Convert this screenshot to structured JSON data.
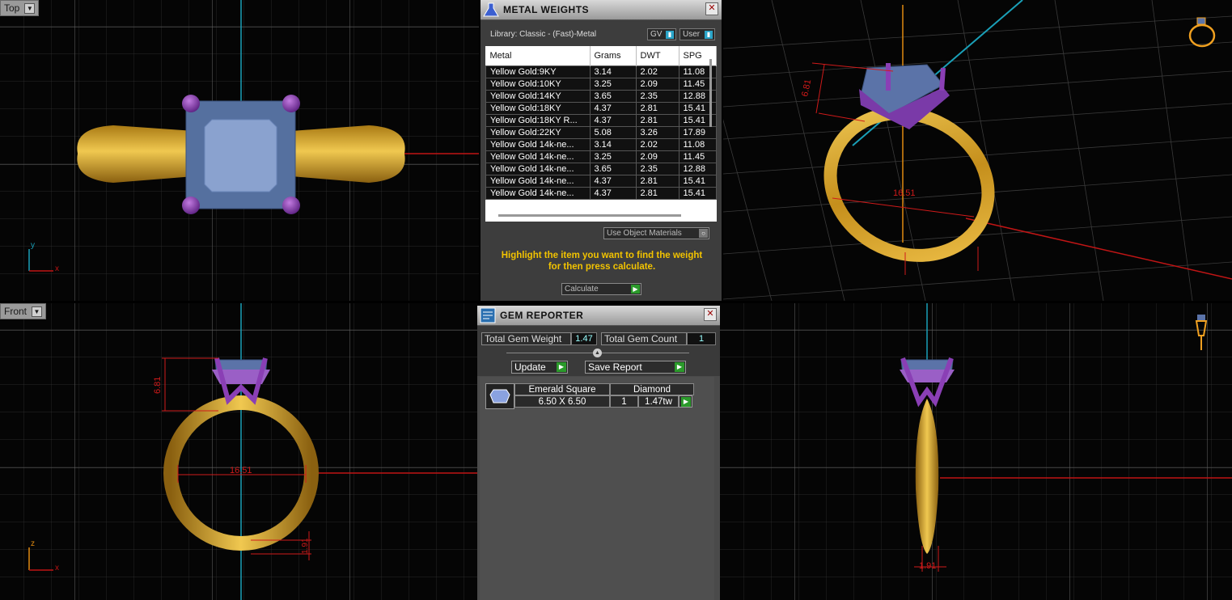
{
  "viewports": {
    "top": {
      "label": "Top"
    },
    "front": {
      "label": "Front"
    }
  },
  "metal_weights": {
    "title": "METAL WEIGHTS",
    "library_label": "Library: Classic - (Fast)-Metal",
    "toggle_gv": "GV",
    "toggle_user": "User",
    "columns": [
      "Metal",
      "Grams",
      "DWT",
      "SPG"
    ],
    "rows": [
      [
        "Yellow Gold:9KY",
        "3.14",
        "2.02",
        "11.08"
      ],
      [
        "Yellow Gold:10KY",
        "3.25",
        "2.09",
        "11.45"
      ],
      [
        "Yellow Gold:14KY",
        "3.65",
        "2.35",
        "12.88"
      ],
      [
        "Yellow Gold:18KY",
        "4.37",
        "2.81",
        "15.41"
      ],
      [
        "Yellow Gold:18KY R...",
        "4.37",
        "2.81",
        "15.41"
      ],
      [
        "Yellow Gold:22KY",
        "5.08",
        "3.26",
        "17.89"
      ],
      [
        "Yellow Gold 14k-ne...",
        "3.14",
        "2.02",
        "11.08"
      ],
      [
        "Yellow Gold 14k-ne...",
        "3.25",
        "2.09",
        "11.45"
      ],
      [
        "Yellow Gold 14k-ne...",
        "3.65",
        "2.35",
        "12.88"
      ],
      [
        "Yellow Gold 14k-ne...",
        "4.37",
        "2.81",
        "15.41"
      ],
      [
        "Yellow Gold 14k-ne...",
        "4.37",
        "2.81",
        "15.41"
      ]
    ],
    "use_object_materials": "Use Object Materials",
    "instruction": "Highlight the item you want to find the weight for then press calculate.",
    "calculate_label": "Calculate"
  },
  "gem_reporter": {
    "title": "GEM REPORTER",
    "total_weight_label": "Total Gem Weight",
    "total_weight_value": "1.47",
    "total_count_label": "Total Gem Count",
    "total_count_value": "1",
    "update_label": "Update",
    "save_report_label": "Save Report",
    "gem": {
      "shape": "Emerald Square",
      "type": "Diamond",
      "size": "6.50 X 6.50",
      "count": "1",
      "weight": "1.47tw"
    }
  },
  "dimensions": {
    "top_right_height": "6.81",
    "top_right_diameter": "16.51",
    "front_height": "6.81",
    "front_diameter": "16.51",
    "front_thickness": "1.91",
    "right_thickness": "1.91"
  },
  "axes": {
    "x": "x",
    "y": "y",
    "z": "z"
  },
  "colors": {
    "gold": "#d4a32a",
    "stone": "#6f86b8",
    "prong": "#8a3fb5",
    "dimension_red": "#d01a1a",
    "axis_cyan": "#1aa0b8",
    "panel_bg": "#3b3b3b"
  }
}
